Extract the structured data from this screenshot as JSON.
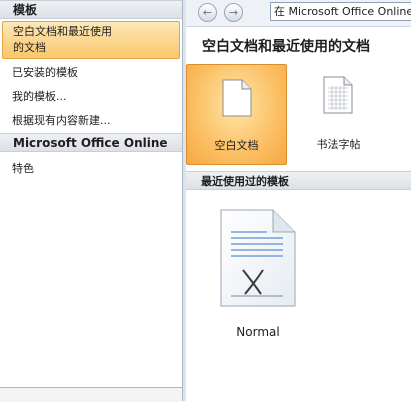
{
  "sidebar": {
    "section_templates": "模板",
    "items": [
      {
        "label": "空白文档和最近使用\n的文档"
      },
      {
        "label": "已安装的模板"
      },
      {
        "label": "我的模板..."
      },
      {
        "label": "根据现有内容新建..."
      }
    ],
    "section_online": "Microsoft Office Online",
    "online_items": [
      {
        "label": "特色"
      }
    ]
  },
  "navbar": {
    "back_icon": "back-arrow-icon",
    "forward_icon": "forward-arrow-icon",
    "search_value": "在 Microsoft Office Online"
  },
  "main": {
    "title": "空白文档和最近使用的文档",
    "tiles": [
      {
        "label": "空白文档",
        "icon": "blank-document-icon"
      },
      {
        "label": "书法字帖",
        "icon": "calligraphy-grid-icon"
      }
    ],
    "recent_header": "最近使用过的模板",
    "recent_items": [
      {
        "label": "Normal",
        "icon": "normal-template-icon"
      }
    ]
  },
  "colors": {
    "selection_orange": "#f9c76c",
    "selection_border": "#e3a640",
    "header_gray": "#dde1e6",
    "pane_border": "#a9b7c9"
  }
}
